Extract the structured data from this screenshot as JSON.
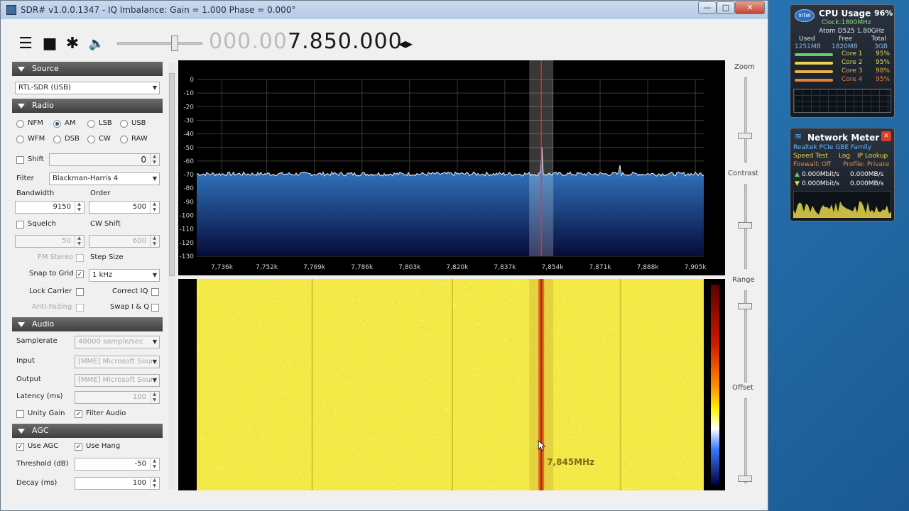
{
  "window": {
    "title": "SDR# v1.0.0.1347 - IQ Imbalance: Gain = 1.000 Phase = 0.000°",
    "min": "—",
    "max": "□",
    "close": "✕"
  },
  "toolbar": {
    "menu_icon": "menu-icon",
    "stop_icon": "stop-icon",
    "settings_icon": "gear-icon",
    "audio_icon": "speaker-icon",
    "freq_dim": "000.00",
    "freq_main": "7.850.000",
    "freq_arrows": "◂▸"
  },
  "source": {
    "header": "Source",
    "device": "RTL-SDR (USB)"
  },
  "radio": {
    "header": "Radio",
    "modes_row1": [
      "NFM",
      "AM",
      "LSB",
      "USB"
    ],
    "modes_row2": [
      "WFM",
      "DSB",
      "CW",
      "RAW"
    ],
    "selected_mode": "AM",
    "shift_label": "Shift",
    "shift_value": "0",
    "filter_label": "Filter",
    "filter_value": "Blackman-Harris 4",
    "bandwidth_label": "Bandwidth",
    "bandwidth_value": "9150",
    "order_label": "Order",
    "order_value": "500",
    "squelch_label": "Squelch",
    "squelch_value": "50",
    "cwshift_label": "CW Shift",
    "cwshift_value": "600",
    "fmstereo_label": "FM Stereo",
    "stepsize_label": "Step Size",
    "snap_label": "Snap to Grid",
    "snap_value": "1 kHz",
    "lockcarrier_label": "Lock Carrier",
    "correctiq_label": "Correct IQ",
    "antifading_label": "Anti-Fading",
    "swapiq_label": "Swap I & Q"
  },
  "audio": {
    "header": "Audio",
    "samplerate_label": "Samplerate",
    "samplerate_value": "48000 sample/sec",
    "input_label": "Input",
    "input_value": "[MME] Microsoft Soun",
    "output_label": "Output",
    "output_value": "[MME] Microsoft Soun",
    "latency_label": "Latency (ms)",
    "latency_value": "100",
    "unity_label": "Unity Gain",
    "filter_label": "Filter Audio"
  },
  "agc": {
    "header": "AGC",
    "useagc_label": "Use AGC",
    "usehang_label": "Use Hang",
    "threshold_label": "Threshold (dB)",
    "threshold_value": "-50",
    "decay_label": "Decay (ms)",
    "decay_value": "100"
  },
  "spectrum": {
    "db_ticks": [
      "0",
      "-10",
      "-20",
      "-30",
      "-40",
      "-50",
      "-60",
      "-70",
      "-80",
      "-90",
      "-100",
      "-110",
      "-120",
      "-130"
    ],
    "freq_ticks": [
      "7,736k",
      "7,752k",
      "7,769k",
      "7,786k",
      "7,803k",
      "7,820k",
      "7,837k",
      "7,854k",
      "7,871k",
      "7,888k",
      "7,905k"
    ],
    "noise_floor_db": -68,
    "peaks": [
      {
        "freq_k": 7850,
        "db": -50
      },
      {
        "freq_k": 7878,
        "db": -63
      }
    ],
    "cursor_label": "7,845MHz"
  },
  "right_controls": {
    "zoom": "Zoom",
    "contrast": "Contrast",
    "range": "Range",
    "offset": "Offset"
  },
  "cpu_gadget": {
    "title": "CPU Usage",
    "percent": "96%",
    "clock": "Clock:1800MHz",
    "cpu_name": "Atom D525 1.80GHz",
    "mem_headers": [
      "Used",
      "Free",
      "Total"
    ],
    "mem_values": [
      "1251MB",
      "1820MB",
      "3GB"
    ],
    "cores": [
      {
        "label": "Core 1",
        "value": "95%"
      },
      {
        "label": "Core 2",
        "value": "95%"
      },
      {
        "label": "Core 3",
        "value": "98%"
      },
      {
        "label": "Core 4",
        "value": "95%"
      }
    ],
    "colors": {
      "core1": "#5fd067",
      "core2": "#e7d84a",
      "core3": "#e7b24a",
      "core4": "#e6823c"
    }
  },
  "net_gadget": {
    "title": "Network Meter",
    "close": "✕",
    "adapter": "Realtek PCIe GBE Family",
    "links": [
      "Speed Test",
      "Log",
      "IP Lookup"
    ],
    "firewall": "Firewall: Off",
    "profile": "Profile: Private",
    "up_mbit": "0.000Mbit/s",
    "up_mb": "0.000MB/s",
    "down_mbit": "0.000Mbit/s",
    "down_mb": "0.000MB/s"
  }
}
